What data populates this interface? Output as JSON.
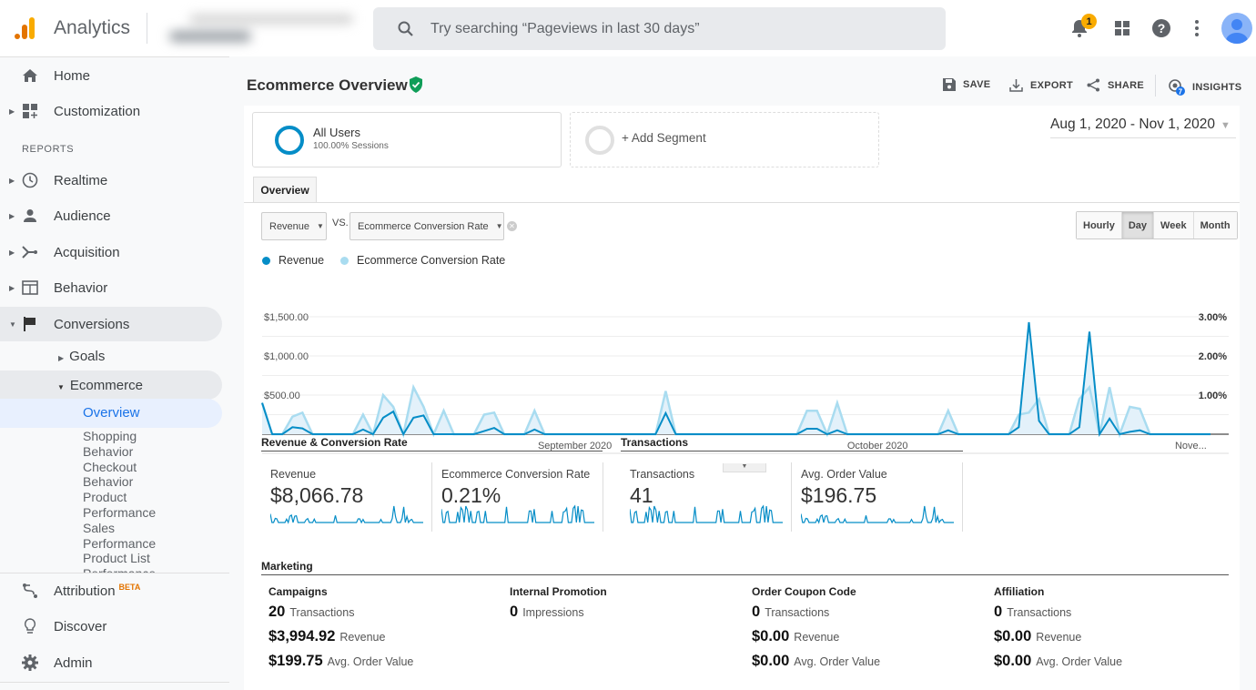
{
  "topbar": {
    "app_name": "Analytics",
    "search_placeholder": "Try searching “Pageviews in last 30 days”",
    "notification_count": "1",
    "icons": [
      "notifications-bell-icon",
      "apps-grid-icon",
      "help-icon",
      "more-vert-icon",
      "account-avatar-icon"
    ]
  },
  "sidebar": {
    "home": "Home",
    "customization": "Customization",
    "reports_label": "REPORTS",
    "realtime": "Realtime",
    "audience": "Audience",
    "acquisition": "Acquisition",
    "behavior": "Behavior",
    "conversions": "Conversions",
    "goals": "Goals",
    "ecommerce": "Ecommerce",
    "overview": "Overview",
    "ecommerce_sub": [
      "Shopping Behavior",
      "Checkout Behavior",
      "Product Performance",
      "Sales Performance",
      "Product List Performance"
    ],
    "attribution": "Attribution",
    "attribution_badge": "BETA",
    "discover": "Discover",
    "admin": "Admin"
  },
  "header": {
    "title": "Ecommerce Overview",
    "actions": {
      "save": "SAVE",
      "export": "EXPORT",
      "share": "SHARE",
      "insights": "INSIGHTS",
      "insights_count": "7"
    }
  },
  "segments": {
    "all_users_title": "All Users",
    "all_users_sub": "100.00% Sessions",
    "add_segment": "+ Add Segment"
  },
  "date_range": "Aug 1, 2020 - Nov 1, 2020",
  "tabs": {
    "overview": "Overview"
  },
  "metric_selectors": {
    "primary": "Revenue",
    "vs": "VS.",
    "secondary": "Ecommerce Conversion Rate"
  },
  "granularity": {
    "options": [
      "Hourly",
      "Day",
      "Week",
      "Month"
    ],
    "selected": "Day"
  },
  "colors": {
    "revenue": "#058dc7",
    "conversion": "#a9dcf0",
    "fill": "#e3f1fa",
    "brand_orange": "#f9ab00"
  },
  "chart_data": {
    "type": "line",
    "title": "",
    "legend": [
      "Revenue",
      "Ecommerce Conversion Rate"
    ],
    "legend_position": "top-left",
    "x_tick_labels": [
      "September 2020",
      "October 2020",
      "Nove..."
    ],
    "x_start": "Aug 1, 2020",
    "x_end": "Nov 1, 2020",
    "y_left_ticks": [
      "$500.00",
      "$1,000.00",
      "$1,500.00"
    ],
    "y_left_range": [
      0,
      1500
    ],
    "y_right_ticks": [
      "1.00%",
      "2.00%",
      "3.00%"
    ],
    "y_right_range": [
      0,
      3
    ],
    "grid": true,
    "series": [
      {
        "name": "Revenue",
        "axis": "left",
        "values": [
          400,
          0,
          0,
          90,
          75,
          0,
          0,
          0,
          0,
          0,
          60,
          0,
          210,
          290,
          0,
          210,
          240,
          0,
          0,
          0,
          0,
          0,
          40,
          80,
          0,
          0,
          0,
          60,
          0,
          0,
          0,
          0,
          0,
          0,
          0,
          0,
          0,
          0,
          0,
          0,
          270,
          0,
          0,
          0,
          0,
          0,
          0,
          0,
          0,
          0,
          0,
          0,
          0,
          0,
          70,
          70,
          0,
          50,
          0,
          0,
          0,
          0,
          0,
          0,
          0,
          0,
          0,
          0,
          50,
          0,
          0,
          0,
          0,
          0,
          0,
          90,
          1430,
          170,
          0,
          0,
          0,
          90,
          1310,
          0,
          200,
          0,
          30,
          50,
          0,
          0,
          0,
          0,
          0,
          0,
          0
        ]
      },
      {
        "name": "Ecommerce Conversion Rate",
        "axis": "right",
        "values": [
          0.8,
          0,
          0,
          0.45,
          0.55,
          0,
          0,
          0,
          0,
          0,
          0.5,
          0,
          1.0,
          0.7,
          0,
          1.2,
          0.7,
          0,
          0.6,
          0,
          0,
          0,
          0.5,
          0.55,
          0,
          0,
          0,
          0.6,
          0,
          0,
          0,
          0,
          0,
          0,
          0,
          0,
          0,
          0,
          0,
          0,
          1.1,
          0,
          0,
          0,
          0,
          0,
          0,
          0,
          0,
          0,
          0,
          0,
          0,
          0,
          0.6,
          0.6,
          0,
          0.8,
          0,
          0,
          0,
          0,
          0,
          0,
          0,
          0,
          0,
          0,
          0.6,
          0,
          0,
          0,
          0,
          0,
          0,
          0.5,
          0.55,
          0.9,
          0,
          0,
          0,
          0.9,
          1.2,
          0,
          1.2,
          0,
          0.7,
          0.65,
          0,
          0,
          0,
          0,
          0,
          0,
          0
        ]
      }
    ]
  },
  "summary": {
    "revenue_section": "Revenue & Conversion Rate",
    "transactions_section": "Transactions",
    "metrics": [
      {
        "label": "Revenue",
        "value": "$8,066.78"
      },
      {
        "label": "Ecommerce Conversion Rate",
        "value": "0.21%"
      },
      {
        "label": "Transactions",
        "value": "41"
      },
      {
        "label": "Avg. Order Value",
        "value": "$196.75"
      }
    ]
  },
  "marketing": {
    "title": "Marketing",
    "columns": [
      {
        "title": "Campaigns",
        "rows": [
          {
            "value": "20",
            "label": "Transactions"
          },
          {
            "value": "$3,994.92",
            "label": "Revenue"
          },
          {
            "value": "$199.75",
            "label": "Avg. Order Value"
          }
        ]
      },
      {
        "title": "Internal Promotion",
        "rows": [
          {
            "value": "0",
            "label": "Impressions"
          }
        ]
      },
      {
        "title": "Order Coupon Code",
        "rows": [
          {
            "value": "0",
            "label": "Transactions"
          },
          {
            "value": "$0.00",
            "label": "Revenue"
          },
          {
            "value": "$0.00",
            "label": "Avg. Order Value"
          }
        ]
      },
      {
        "title": "Affiliation",
        "rows": [
          {
            "value": "0",
            "label": "Transactions"
          },
          {
            "value": "$0.00",
            "label": "Revenue"
          },
          {
            "value": "$0.00",
            "label": "Avg. Order Value"
          }
        ]
      }
    ]
  }
}
